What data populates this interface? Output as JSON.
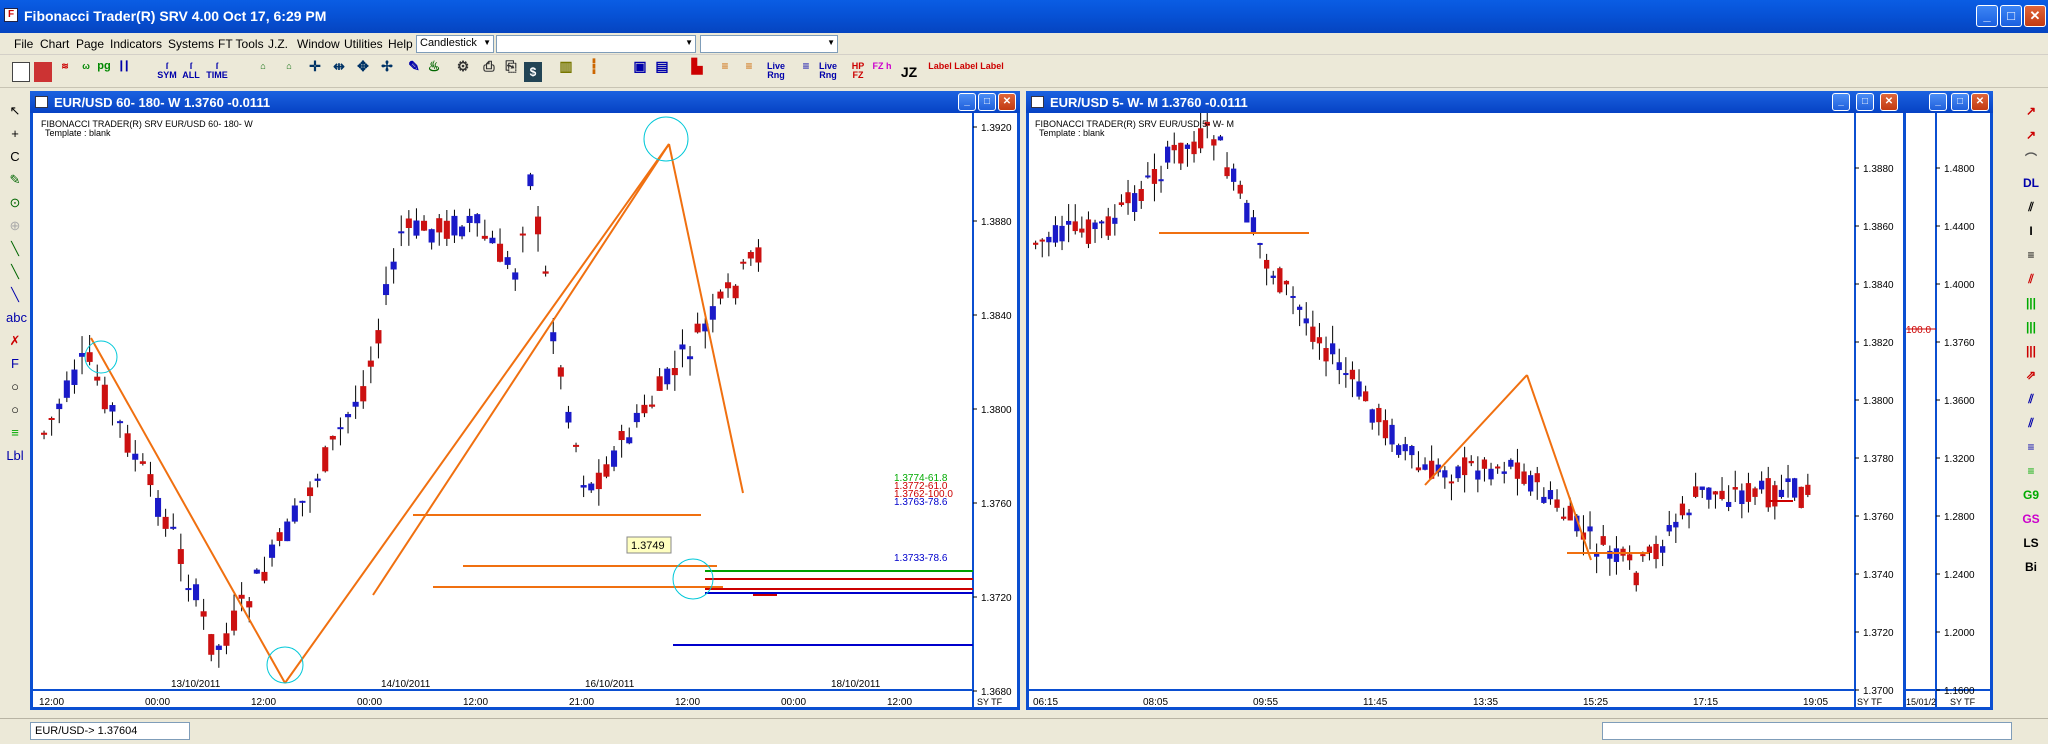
{
  "app": {
    "title": "Fibonacci Trader(R) SRV 4.00 Oct 17,  6:29 PM",
    "window_buttons": {
      "minimize": "_",
      "maximize": "□",
      "close": "✕"
    }
  },
  "menu": {
    "items": [
      "File",
      "Chart",
      "Page",
      "Indicators",
      "Systems",
      "FT Tools",
      "J.Z.",
      "Window",
      "Utilities",
      "Help"
    ],
    "chart_type": "Candlestick",
    "combo2": "",
    "combo3": ""
  },
  "toolbar": {
    "labels": [
      "SYM",
      "ALL",
      "TIME",
      "Live Rng",
      "Live Rng",
      "HP FZ",
      "FZ h",
      "JZ",
      "Label",
      "Label",
      "Label"
    ],
    "accent_color": "#0b4fd1"
  },
  "left_tools": [
    "↖",
    "+",
    "C",
    "✎",
    "⊙",
    "⊕",
    "╲",
    "╲",
    "╲",
    "abc",
    "✗",
    "F",
    "○",
    "○",
    "≡",
    "Lbl"
  ],
  "right_tools": [
    "↗",
    "↗",
    "⌒",
    "DL",
    "⫽",
    "I",
    "≡",
    "⫽",
    "|||",
    "|||",
    "|||",
    "⇗",
    "⫽",
    "⫽",
    "≡",
    "≡",
    "G9",
    "GS",
    "LS",
    "Bi"
  ],
  "chart1": {
    "title": "EUR/USD 60- 180- W  1.3760  -0.0111",
    "header_line1": "FIBONACCI TRADER(R) SRV     EUR/USD 60- 180- W",
    "header_line2": "Template : blank",
    "price_labels": [
      "1.3920",
      "1.3880",
      "1.3840",
      "1.3800",
      "1.3760",
      "1.3720",
      "1.3680"
    ],
    "time_labels": [
      "12:00",
      "00:00",
      "12:00",
      "00:00",
      "12:00",
      "21:00",
      "12:00",
      "00:00",
      "12:00"
    ],
    "date_labels": [
      "13/10/2011",
      "14/10/2011",
      "16/10/2011",
      "18/10/2011"
    ],
    "price_tag": "1.3749",
    "fib_labels": [
      "1.3774-61.8",
      "1.3772-61.0",
      "1.3762-100.0",
      "1.3763-78.6",
      "1.3733-78.6"
    ],
    "corner_label": "SY TF"
  },
  "chart2": {
    "title": "EUR/USD 5- W- M  1.3760  -0.0111",
    "header_line1": "FIBONACCI TRADER(R) SRV     EUR/USD 5- W- M",
    "header_line2": "Template : blank",
    "price_labels": [
      "1.3880",
      "1.3860",
      "1.3840",
      "1.3820",
      "1.3800",
      "1.3780",
      "1.3760",
      "1.3740",
      "1.3720",
      "1.3700"
    ],
    "time_labels": [
      "06:15",
      "08:05",
      "09:55",
      "11:45",
      "13:35",
      "15:25",
      "17:15",
      "19:05"
    ],
    "corner_label": "SY TF"
  },
  "chart3": {
    "price_labels": [
      "1.4800",
      "1.4400",
      "1.4000",
      "1.3760",
      "1.3600",
      "1.3200",
      "1.2800",
      "1.2400",
      "1.2000",
      "1.1600"
    ],
    "marker_label": "100.0",
    "date_label": "15/01/2",
    "corner_label": "SY TF"
  },
  "status": {
    "quote": "EUR/USD-> 1.37604",
    "right_field": ""
  }
}
